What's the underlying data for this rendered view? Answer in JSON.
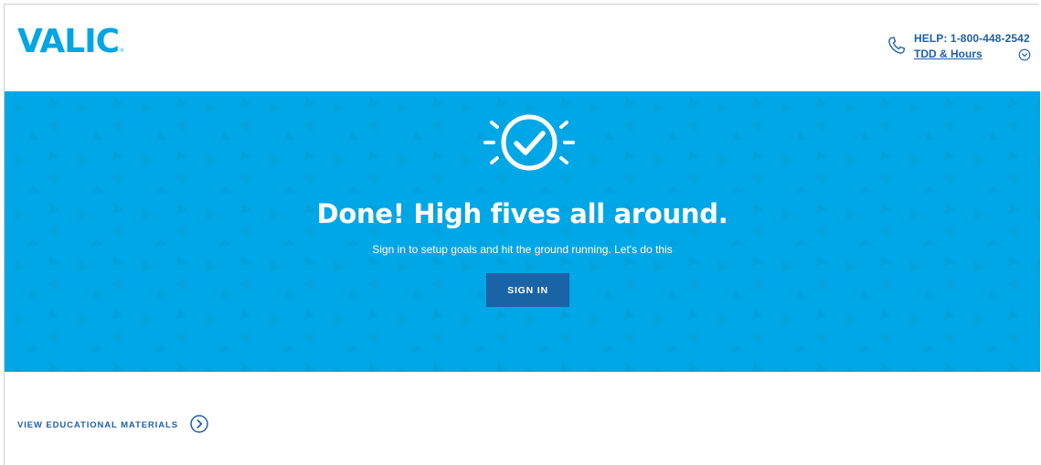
{
  "header": {
    "logo_text": "VALIC",
    "logo_tm": "®",
    "help_label": "HELP: 1-800-448-2542",
    "tdd_label": "TDD & Hours",
    "icons": {
      "phone": "phone-icon",
      "expand": "chevron-down-circle-icon"
    }
  },
  "hero": {
    "title": "Done! High fives all around.",
    "subtitle": "Sign in to setup goals and hit the ground running. Let's do this",
    "sign_in_label": "SIGN IN",
    "icon": "check-circle-burst-icon",
    "background_color": "#00a7e6",
    "button_color": "#1a63a6"
  },
  "footer": {
    "edu_label": "VIEW EDUCATIONAL MATERIALS",
    "edu_icon": "chevron-right-circle-icon"
  },
  "colors": {
    "brand_blue": "#00a5e3",
    "link_blue": "#1f5fa6"
  }
}
